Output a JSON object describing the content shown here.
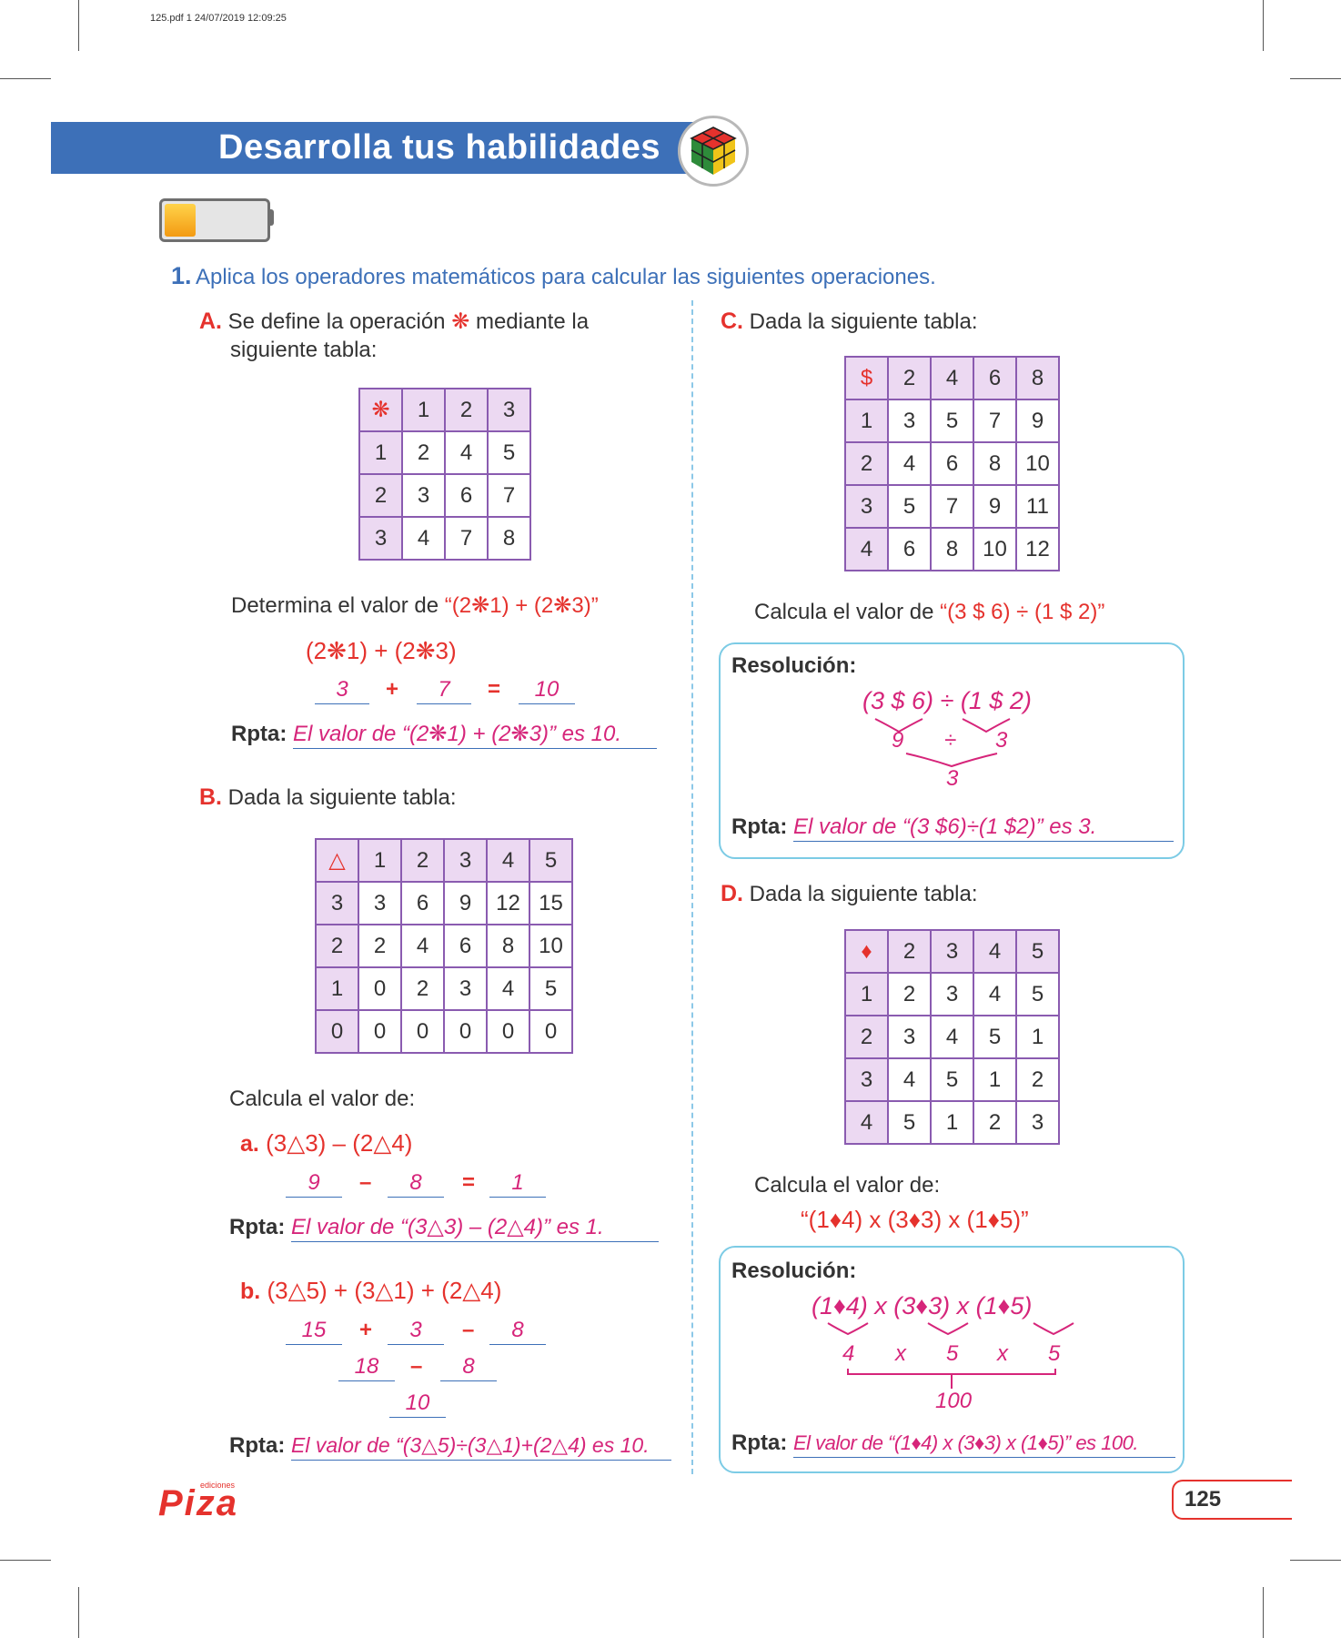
{
  "meta": "125.pdf  1  24/07/2019  12:09:25",
  "header": {
    "title": "Desarrolla tus habilidades"
  },
  "question": {
    "number": "1.",
    "text": "Aplica los operadores matemáticos para calcular las siguientes operaciones."
  },
  "A": {
    "letter": "A.",
    "intro_1": "Se define la operación",
    "op": "❋",
    "intro_2": "mediante la",
    "intro_3": "siguiente tabla:",
    "table": [
      [
        "❋",
        "1",
        "2",
        "3"
      ],
      [
        "1",
        "2",
        "4",
        "5"
      ],
      [
        "2",
        "3",
        "6",
        "7"
      ],
      [
        "3",
        "4",
        "7",
        "8"
      ]
    ],
    "prompt": "Determina el valor de",
    "expr": "“(2❋1) + (2❋3)”",
    "line1": "(2❋1) + (2❋3)",
    "v1": "3",
    "plus": "+",
    "v2": "7",
    "eq": "=",
    "v3": "10",
    "rpta_label": "Rpta:",
    "rpta": "El valor de “(2❋1) + (2❋3)” es 10."
  },
  "B": {
    "letter": "B.",
    "intro": "Dada la siguiente tabla:",
    "table": [
      [
        "△",
        "1",
        "2",
        "3",
        "4",
        "5"
      ],
      [
        "3",
        "3",
        "6",
        "9",
        "12",
        "15"
      ],
      [
        "2",
        "2",
        "4",
        "6",
        "8",
        "10"
      ],
      [
        "1",
        "0",
        "2",
        "3",
        "4",
        "5"
      ],
      [
        "0",
        "0",
        "0",
        "0",
        "0",
        "0"
      ]
    ],
    "prompt": "Calcula el valor de:",
    "a": {
      "label": "a.",
      "expr": "(3△3) – (2△4)",
      "v1": "9",
      "op": "–",
      "v2": "8",
      "eq": "=",
      "v3": "1",
      "rpta_label": "Rpta:",
      "rpta": "El valor de “(3△3) – (2△4)” es 1."
    },
    "b": {
      "label": "b.",
      "expr": "(3△5) + (3△1) + (2△4)",
      "v1": "15",
      "op1": "+",
      "v2": "3",
      "op2": "–",
      "v3": "8",
      "w1": "18",
      "op3": "–",
      "w2": "8",
      "result": "10",
      "rpta_label": "Rpta:",
      "rpta": "El valor de “(3△5)÷(3△1)+(2△4) es 10."
    }
  },
  "C": {
    "letter": "C.",
    "intro": "Dada la siguiente tabla:",
    "table": [
      [
        "$",
        "2",
        "4",
        "6",
        "8"
      ],
      [
        "1",
        "3",
        "5",
        "7",
        "9"
      ],
      [
        "2",
        "4",
        "6",
        "8",
        "10"
      ],
      [
        "3",
        "5",
        "7",
        "9",
        "11"
      ],
      [
        "4",
        "6",
        "8",
        "10",
        "12"
      ]
    ],
    "prompt": "Calcula el valor de",
    "expr": "“(3 $ 6) ÷ (1 $ 2)”",
    "res_title": "Resolución:",
    "res_expr": "(3 $ 6) ÷ (1 $ 2)",
    "r1": "9",
    "rop": "÷",
    "r2": "3",
    "result": "3",
    "rpta_label": "Rpta:",
    "rpta": "El valor de “(3 $6)÷(1 $2)” es 3."
  },
  "D": {
    "letter": "D.",
    "intro": "Dada la siguiente tabla:",
    "table": [
      [
        "♦",
        "2",
        "3",
        "4",
        "5"
      ],
      [
        "1",
        "2",
        "3",
        "4",
        "5"
      ],
      [
        "2",
        "3",
        "4",
        "5",
        "1"
      ],
      [
        "3",
        "4",
        "5",
        "1",
        "2"
      ],
      [
        "4",
        "5",
        "1",
        "2",
        "3"
      ]
    ],
    "prompt": "Calcula el valor de:",
    "expr": "“(1♦4) x (3♦3) x (1♦5)”",
    "res_title": "Resolución:",
    "res_expr": "(1♦4) x (3♦3) x (1♦5)",
    "r1": "4",
    "rop1": "x",
    "r2": "5",
    "rop2": "x",
    "r3": "5",
    "result": "100",
    "rpta_label": "Rpta:",
    "rpta": "El valor de “(1♦4) x (3♦3) x (1♦5)” es 100."
  },
  "footer": {
    "logo": "Piza",
    "logo_small": "ediciones",
    "page": "125"
  }
}
